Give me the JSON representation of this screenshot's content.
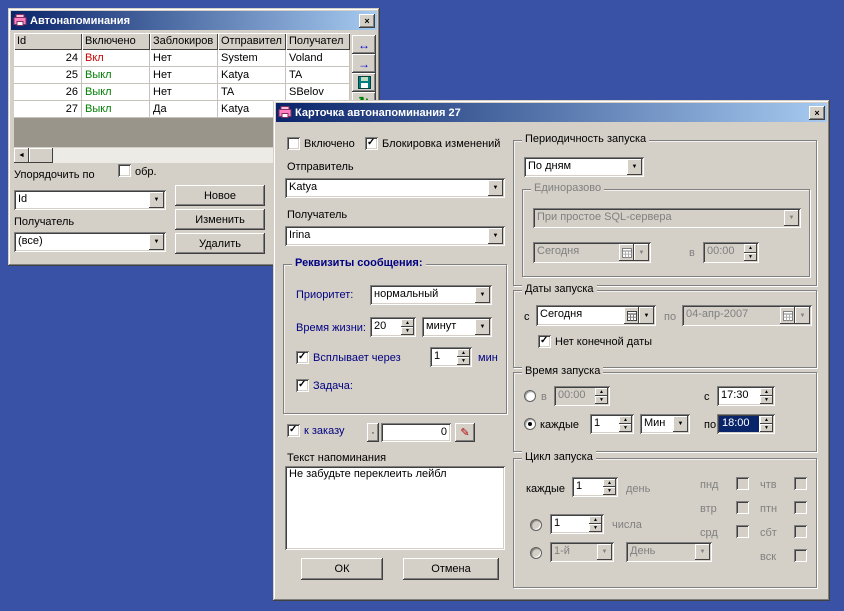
{
  "colors": {
    "desktop": "#3a52a5",
    "title_start": "#0a246a",
    "title_end": "#a6caf0",
    "face": "#d4d0c8",
    "label_blue": "#000080",
    "enabled_on": "#cc0000",
    "enabled_off": "#008000",
    "selection": "#0a246a"
  },
  "icons": {
    "close": "×",
    "dropdown": "▼",
    "spin_up": "▲",
    "spin_down": "▼",
    "check": "✓",
    "scroll_left": "◄",
    "scroll_right": "►",
    "nav_swap": "↔",
    "nav_go": "→",
    "refresh": "↻",
    "edit": "✎",
    "dot_button": "·"
  },
  "back_window": {
    "title": "Автонапоминания",
    "grid": {
      "columns": [
        "Id",
        "Включено",
        "Заблокиров",
        "Отправител",
        "Получател"
      ],
      "rows": [
        {
          "id": "24",
          "state": "Вкл",
          "locked": "Нет",
          "sender": "System",
          "recipient": "Voland"
        },
        {
          "id": "25",
          "state": "Выкл",
          "locked": "Нет",
          "sender": "Katya",
          "recipient": "TA"
        },
        {
          "id": "26",
          "state": "Выкл",
          "locked": "Нет",
          "sender": "TA",
          "recipient": "SBelov"
        },
        {
          "id": "27",
          "state": "Выкл",
          "locked": "Да",
          "sender": "Katya",
          "recipient": ""
        }
      ]
    },
    "sort": {
      "order_label": "Упорядочить по",
      "reverse_label": "обр.",
      "order_value": "Id",
      "recipient_label": "Получатель",
      "recipient_value": "(все)"
    },
    "actions": {
      "new": "Новое",
      "edit": "Изменить",
      "delete": "Удалить"
    }
  },
  "card_window": {
    "title": "Карточка автонапоминания 27",
    "enabled_label": "Включено",
    "lock_label": "Блокировка изменений",
    "sender_label": "Отправитель",
    "sender_value": "Katya",
    "recipient_label": "Получатель",
    "recipient_value": "Irina",
    "message": {
      "title": "Реквизиты сообщения:",
      "priority_label": "Приоритет:",
      "priority_value": "нормальный",
      "lifetime_label": "Время жизни:",
      "lifetime_value": "20",
      "lifetime_unit": "минут",
      "popup_label": "Всплывает через",
      "popup_value": "1",
      "popup_unit": "мин",
      "task_label": "Задача:"
    },
    "order": {
      "label": "к заказу",
      "value": "0"
    },
    "text_label": "Текст напоминания",
    "text_value": "Не забудьте переклеить лейбл",
    "ok": "ОК",
    "cancel": "Отмена",
    "periodicity": {
      "title": "Периодичность запуска",
      "value": "По дням",
      "onetime": {
        "title": "Единоразово",
        "trigger": "При простое SQL-сервера",
        "date": "Сегодня",
        "at_label": "в",
        "time": "00:00"
      }
    },
    "dates": {
      "title": "Даты запуска",
      "from_label": "с",
      "from_value": "Сегодня",
      "to_label": "по",
      "to_value": "04-апр-2007",
      "no_end": "Нет конечной даты"
    },
    "times": {
      "title": "Время запуска",
      "at_label": "в",
      "at_value": "00:00",
      "from_label": "с",
      "from_value": "17:30",
      "every_label": "каждые",
      "every_value": "1",
      "every_unit": "Мин",
      "to_label": "по",
      "to_value": "18:00"
    },
    "cycle": {
      "title": "Цикл запуска",
      "every_label": "каждые",
      "every_value": "1",
      "every_unit": "день",
      "weekdays_col1": [
        "пнд",
        "втр",
        "срд"
      ],
      "weekdays_col2": [
        "чтв",
        "птн",
        "сбт",
        "вск"
      ],
      "monthday_value": "1",
      "monthday_label": "числа",
      "ordinal_value": "1-й",
      "unit_value": "День"
    }
  }
}
